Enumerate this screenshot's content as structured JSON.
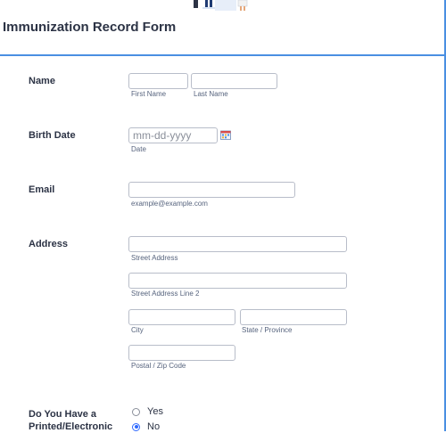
{
  "form": {
    "title": "Immunization Record Form"
  },
  "fields": {
    "name": {
      "label": "Name",
      "first_sublabel": "First Name",
      "last_sublabel": "Last Name"
    },
    "birth_date": {
      "label": "Birth Date",
      "placeholder": "mm-dd-yyyy",
      "sublabel": "Date"
    },
    "email": {
      "label": "Email",
      "sublabel": "example@example.com"
    },
    "address": {
      "label": "Address",
      "street_sublabel": "Street Address",
      "street2_sublabel": "Street Address Line 2",
      "city_sublabel": "City",
      "state_sublabel": "State / Province",
      "zip_sublabel": "Postal / Zip Code"
    },
    "printed_record": {
      "label_line1": "Do You Have a",
      "label_line2": "Printed/Electronic",
      "options": [
        "Yes",
        "No"
      ],
      "selected": "No"
    }
  },
  "icons": {
    "calendar": "calendar-icon",
    "hero": "header-illustration"
  },
  "colors": {
    "accent": "#4a8fe2",
    "radio_selected": "#2e69ff",
    "text": "#2c3345",
    "sublabel": "#57647e"
  }
}
